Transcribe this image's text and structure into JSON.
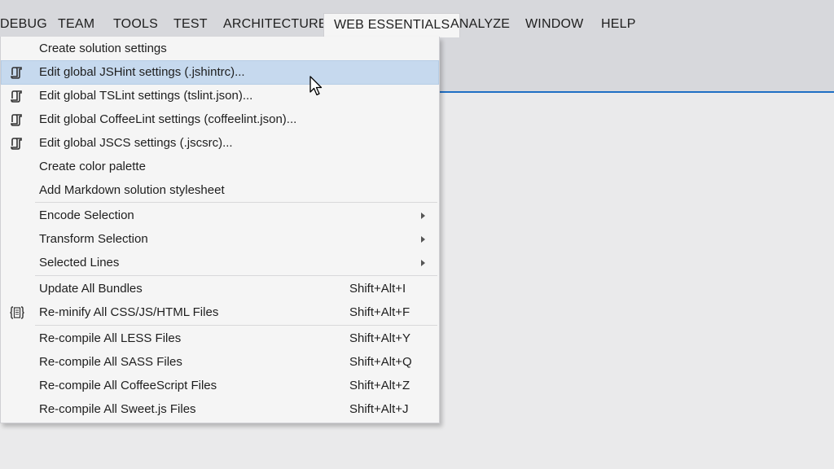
{
  "menubar": {
    "items": [
      {
        "label": "DEBUG"
      },
      {
        "label": "TEAM"
      },
      {
        "label": "TOOLS"
      },
      {
        "label": "TEST"
      },
      {
        "label": "ARCHITECTURE"
      },
      {
        "label": "WEB ESSENTIALS"
      },
      {
        "label": "ANALYZE"
      },
      {
        "label": "WINDOW"
      },
      {
        "label": "HELP"
      }
    ]
  },
  "dropdown": {
    "items": [
      {
        "label": "Create solution settings"
      },
      {
        "label": "Edit global JSHint settings (.jshintrc)...",
        "icon": "settings-file-icon"
      },
      {
        "label": "Edit global TSLint settings (tslint.json)...",
        "icon": "settings-file-icon"
      },
      {
        "label": "Edit global CoffeeLint settings (coffeelint.json)...",
        "icon": "settings-file-icon"
      },
      {
        "label": "Edit global JSCS settings (.jscsrc)...",
        "icon": "settings-file-icon"
      },
      {
        "label": "Create color palette"
      },
      {
        "label": "Add Markdown solution stylesheet"
      },
      {
        "label": "Encode Selection"
      },
      {
        "label": "Transform Selection"
      },
      {
        "label": "Selected Lines"
      },
      {
        "label": "Update All Bundles",
        "shortcut": "Shift+Alt+I"
      },
      {
        "label": "Re-minify All CSS/JS/HTML Files",
        "shortcut": "Shift+Alt+F",
        "icon": "minify-braces-icon"
      },
      {
        "label": "Re-compile All LESS Files",
        "shortcut": "Shift+Alt+Y"
      },
      {
        "label": "Re-compile All SASS Files",
        "shortcut": "Shift+Alt+Q"
      },
      {
        "label": "Re-compile All CoffeeScript Files",
        "shortcut": "Shift+Alt+Z"
      },
      {
        "label": "Re-compile All Sweet.js Files",
        "shortcut": "Shift+Alt+J"
      }
    ]
  },
  "colors": {
    "accent": "#1f6fc4",
    "highlight": "#c6d9ee",
    "menu_background": "#f5f5f5",
    "chrome_background": "#d7d8dc"
  }
}
